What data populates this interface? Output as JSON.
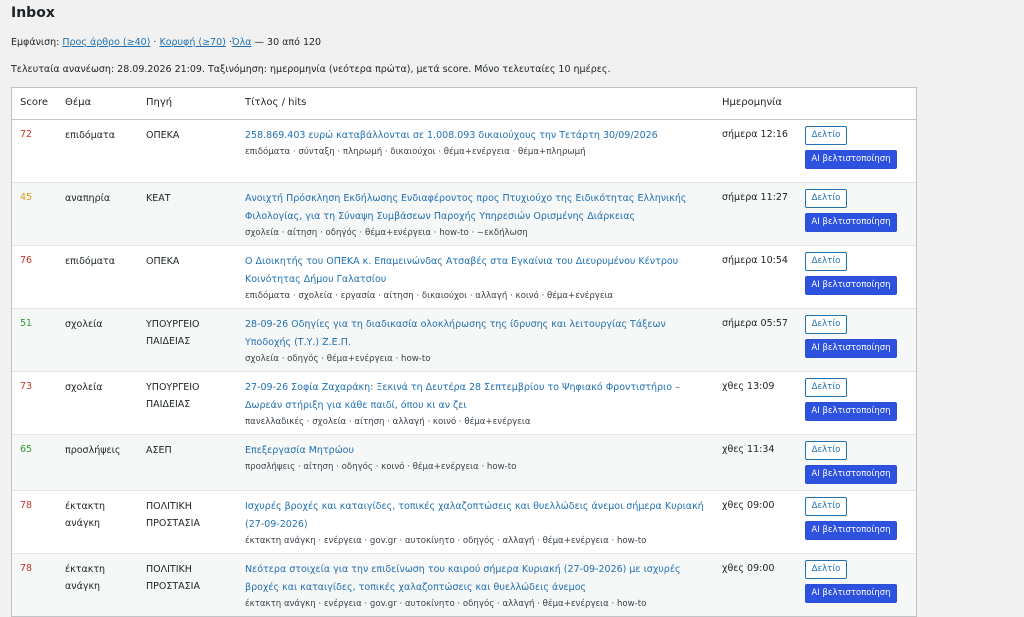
{
  "page": {
    "title": "Inbox"
  },
  "filters": {
    "label": "Εμφάνιση:",
    "links": [
      "Προς άρθρο (≥40)",
      "Κορυφή (≥70)",
      "Όλα"
    ],
    "separator": "·",
    "count_text": "— 30 από 120"
  },
  "info": {
    "text": "Τελευταία ανανέωση: 28.09.2026 21:09. Ταξινόμηση: ημερομηνία (νεότερα πρώτα), μετά score. Μόνο τελευταίες 10 ημέρες."
  },
  "table": {
    "headers": {
      "score": "Score",
      "topic": "Θέμα",
      "source": "Πηγή",
      "title": "Τίτλος / hits",
      "date": "Ημερομηνία"
    },
    "button_report": "Δελτίο",
    "button_ai": "AI βελτιστοποίηση",
    "score_colors": {
      "high": "#c0392b",
      "mid": "#d4a017",
      "low": "#2e9e34"
    },
    "rows": [
      {
        "score": "72",
        "level": "high",
        "topic": "επιδόματα",
        "source": "ΟΠΕΚΑ",
        "title": "258.869.403 ευρώ καταβάλλονται σε 1.008.093 δικαιούχους την Τετάρτη 30/09/2026",
        "hits": "επιδόματα · σύνταξη · πληρωμή · δικαιούχοι · θέμα+ενέργεια · θέμα+πληρωμή",
        "date": "σήμερα 12:16"
      },
      {
        "score": "45",
        "level": "mid",
        "topic": "αναπηρία",
        "source": "ΚΕΑΤ",
        "title": "Ανοιχτή Πρόσκληση Εκδήλωσης Ενδιαφέροντος προς Πτυχιούχο της Ειδικότητας Ελληνικής Φιλολογίας, για τη Σύναψη Συμβάσεων Παροχής Υπηρεσιών Ορισμένης Διάρκειας",
        "hits": "σχολεία · αίτηση · οδηγός · θέμα+ενέργεια · how-to · −εκδήλωση",
        "date": "σήμερα 11:27"
      },
      {
        "score": "76",
        "level": "high",
        "topic": "επιδόματα",
        "source": "ΟΠΕΚΑ",
        "title": "Ο Διοικητής του ΟΠΕΚΑ κ. Επαμεινώνδας Ατσαβές στα Εγκαίνια του Διευρυμένου Κέντρου Κοινότητας Δήμου Γαλατσίου",
        "hits": "επιδόματα · σχολεία · εργασία · αίτηση · δικαιούχοι · αλλαγή · κοινό · θέμα+ενέργεια",
        "date": "σήμερα 10:54"
      },
      {
        "score": "51",
        "level": "low",
        "topic": "σχολεία",
        "source": "ΥΠΟΥΡΓΕΙΟ ΠΑΙΔΕΙΑΣ",
        "title": "28-09-26 Οδηγίες για τη διαδικασία ολοκλήρωσης της ίδρυσης και λειτουργίας Τάξεων Υποδοχής (Τ.Υ.) Ζ.Ε.Π.",
        "hits": "σχολεία · οδηγός · θέμα+ενέργεια · how-to",
        "date": "σήμερα 05:57"
      },
      {
        "score": "73",
        "level": "high",
        "topic": "σχολεία",
        "source": "ΥΠΟΥΡΓΕΙΟ ΠΑΙΔΕΙΑΣ",
        "title": "27-09-26 Σοφία Ζαχαράκη: Ξεκινά τη Δευτέρα 28 Σεπτεμβρίου το Ψηφιακό Φροντιστήριο – Δωρεάν στήριξη για κάθε παιδί, όπου κι αν ζει",
        "hits": "πανελλαδικές · σχολεία · αίτηση · αλλαγή · κοινό · θέμα+ενέργεια",
        "date": "χθες 13:09"
      },
      {
        "score": "65",
        "level": "low",
        "topic": "προσλήψεις",
        "source": "ΑΣΕΠ",
        "title": "Επεξεργασία Μητρώου",
        "hits": "προσλήψεις · αίτηση · οδηγός · κοινό · θέμα+ενέργεια · how-to",
        "date": "χθες 11:34"
      },
      {
        "score": "78",
        "level": "high",
        "topic": "έκτακτη ανάγκη",
        "source": "ΠΟΛΙΤΙΚΗ ΠΡΟΣΤΑΣΙΑ",
        "title": "Ισχυρές βροχές και καταιγίδες, τοπικές χαλαζοπτώσεις και θυελλώδεις άνεμοι σήμερα Κυριακή (27-09-2026)",
        "hits": "έκτακτη ανάγκη · ενέργεια · gov.gr · αυτοκίνητο · οδηγός · αλλαγή · θέμα+ενέργεια · how-to",
        "date": "χθες 09:00"
      },
      {
        "score": "78",
        "level": "high",
        "topic": "έκτακτη ανάγκη",
        "source": "ΠΟΛΙΤΙΚΗ ΠΡΟΣΤΑΣΙΑ",
        "title": "Νεότερα στοιχεία για την επιδείνωση του καιρού σήμερα Κυριακή (27-09-2026) με ισχυρές βροχές και καταιγίδες, τοπικές χαλαζοπτώσεις και θυελλώδεις άνεμος",
        "hits": "έκτακτη ανάγκη · ενέργεια · gov.gr · αυτοκίνητο · οδηγός · αλλαγή · θέμα+ενέργεια · how-to",
        "date": "χθες 09:00"
      }
    ]
  }
}
